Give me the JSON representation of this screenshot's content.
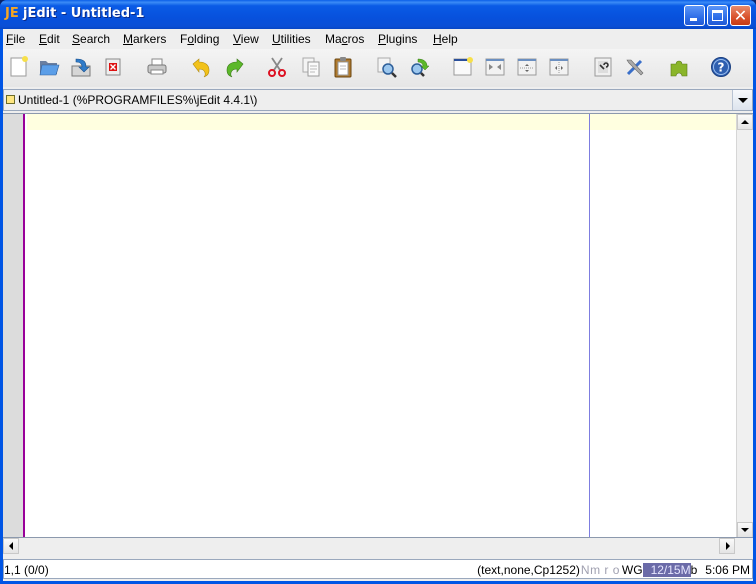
{
  "window": {
    "title": "jEdit - Untitled-1",
    "app_icon": "jedit-logo-icon",
    "controls": [
      "minimize",
      "maximize",
      "close"
    ]
  },
  "menubar": {
    "items": [
      {
        "label": "File",
        "mnemonic": "F"
      },
      {
        "label": "Edit",
        "mnemonic": "E"
      },
      {
        "label": "Search",
        "mnemonic": "S"
      },
      {
        "label": "Markers",
        "mnemonic": "M"
      },
      {
        "label": "Folding",
        "mnemonic": "o"
      },
      {
        "label": "View",
        "mnemonic": "V"
      },
      {
        "label": "Utilities",
        "mnemonic": "U"
      },
      {
        "label": "Macros",
        "mnemonic": "c"
      },
      {
        "label": "Plugins",
        "mnemonic": "P"
      },
      {
        "label": "Help",
        "mnemonic": "H"
      }
    ]
  },
  "toolbar": {
    "buttons": [
      {
        "name": "new-file",
        "icon": "new-file-icon"
      },
      {
        "name": "open",
        "icon": "open-folder-icon"
      },
      {
        "name": "save",
        "icon": "save-icon"
      },
      {
        "name": "close",
        "icon": "close-buffer-icon"
      },
      {
        "name": "print",
        "icon": "printer-icon"
      },
      {
        "name": "undo",
        "icon": "undo-icon"
      },
      {
        "name": "redo",
        "icon": "redo-icon"
      },
      {
        "name": "cut",
        "icon": "scissors-icon"
      },
      {
        "name": "copy",
        "icon": "copy-icon"
      },
      {
        "name": "paste",
        "icon": "clipboard-icon"
      },
      {
        "name": "find",
        "icon": "find-icon"
      },
      {
        "name": "find-in-files",
        "icon": "find-next-icon"
      },
      {
        "name": "new-view",
        "icon": "new-view-icon"
      },
      {
        "name": "unsplit",
        "icon": "unsplit-icon"
      },
      {
        "name": "split-horizontal",
        "icon": "split-horizontal-icon"
      },
      {
        "name": "split-vertical",
        "icon": "split-vertical-icon"
      },
      {
        "name": "buffer-options",
        "icon": "buffer-options-icon"
      },
      {
        "name": "global-options",
        "icon": "tools-icon"
      },
      {
        "name": "plugin-manager",
        "icon": "puzzle-piece-icon"
      },
      {
        "name": "help",
        "icon": "help-icon"
      }
    ]
  },
  "buffer_switcher": {
    "selected": "Untitled-1 (%PROGRAMFILES%\\jEdit 4.4.1\\)"
  },
  "editor": {
    "content": "",
    "colors": {
      "gutter_border": "#990099",
      "current_line": "#ffffe0",
      "wrap_guide": "#7d7de0"
    }
  },
  "statusbar": {
    "caret": "1,1 (0/0)",
    "mode": "(text,none,Cp1252)",
    "flags_dim": "Nm r o",
    "flags_on": "WG",
    "memory": "12/15M",
    "memory_tail": "b",
    "clock": "5:06 PM"
  }
}
